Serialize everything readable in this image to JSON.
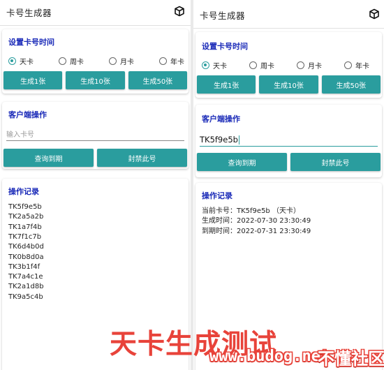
{
  "left": {
    "app_title": "卡号生成器",
    "set_card": {
      "title": "设置卡号时间",
      "options": [
        "天卡",
        "周卡",
        "月卡",
        "年卡"
      ],
      "selected": "天卡",
      "buttons": [
        "生成1张",
        "生成10张",
        "生成50张"
      ]
    },
    "client": {
      "title": "客户端操作",
      "input_value": "",
      "input_placeholder": "输入卡号",
      "buttons": [
        "查询到期",
        "封禁此号"
      ]
    },
    "log": {
      "title": "操作记录",
      "lines": [
        "TK5f9e5b",
        "TK2a5a2b",
        "TK1a7f4b",
        "TK7f1c7b",
        "TK6d4b0d",
        "TK0b8d0a",
        "TK3b1f4f",
        "TK7a4c1e",
        "TK2a1d8b",
        "TK9a5c4b"
      ]
    }
  },
  "right": {
    "app_title": "卡号生成器",
    "set_card": {
      "title": "设置卡号时间",
      "options": [
        "天卡",
        "周卡",
        "月卡",
        "年卡"
      ],
      "selected": "天卡",
      "buttons": [
        "生成1张",
        "生成10张",
        "生成50张"
      ]
    },
    "client": {
      "title": "客户端操作",
      "input_value": "TK5f9e5b",
      "input_placeholder": "",
      "buttons": [
        "查询到期",
        "封禁此号"
      ]
    },
    "log": {
      "title": "操作记录",
      "lines": [
        "当前卡号：TK5f9e5b （天卡）",
        "生成时间：2022-07-30 23:30:49",
        "到期时间：2022-07-31 23:30:49"
      ]
    }
  },
  "watermark": {
    "caption": "天卡生成测试",
    "site": "www.budog.net",
    "brand": "不懂社区"
  },
  "colors": {
    "accent": "#2a9d9e",
    "section_title": "#1a2ab8",
    "watermark": "#e8433a"
  },
  "icons": [
    "cube-icon"
  ]
}
